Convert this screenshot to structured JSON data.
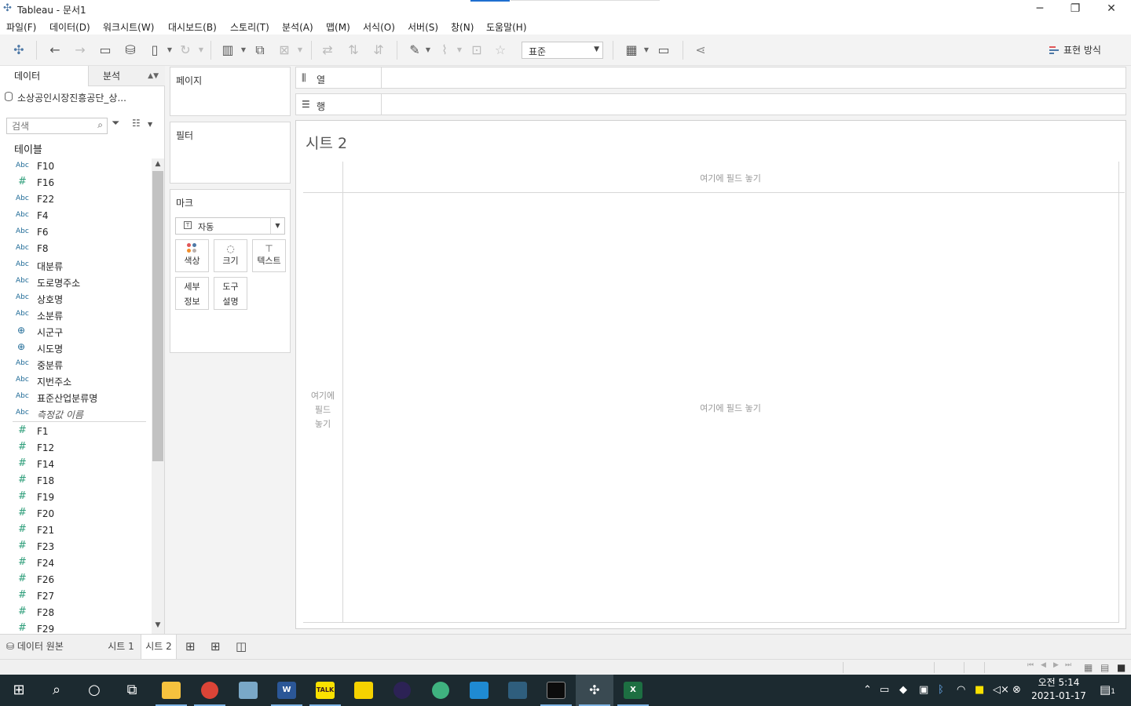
{
  "window": {
    "title": "Tableau - 문서1",
    "controls": {
      "minimize": "─",
      "restore": "❐",
      "close": "✕"
    }
  },
  "menu": [
    "파일(F)",
    "데이터(D)",
    "워크시트(W)",
    "대시보드(B)",
    "스토리(T)",
    "분석(A)",
    "맵(M)",
    "서식(O)",
    "서버(S)",
    "창(N)",
    "도움말(H)"
  ],
  "toolbar": {
    "fit_value": "표준",
    "show_me_label": "표현 방식",
    "icons": [
      "tableau-logo-icon",
      "undo-icon",
      "redo-icon",
      "save-icon",
      "new-datasource-icon",
      "pause-updates-icon",
      "refresh-icon",
      "new-worksheet-icon",
      "duplicate-icon",
      "clear-icon",
      "swap-icon",
      "sort-asc-icon",
      "sort-desc-icon",
      "highlight-icon",
      "group-icon",
      "labels-icon",
      "pin-icon",
      "card-view-icon",
      "presentation-icon",
      "share-icon"
    ]
  },
  "data_pane": {
    "tab_data": "데이터",
    "tab_analysis": "분석",
    "data_source": "소상공인시장진흥공단_상...",
    "search_placeholder": "검색",
    "tables_header": "테이블",
    "dimensions": [
      {
        "type": "Abc",
        "name": "F10"
      },
      {
        "type": "#",
        "name": "F16"
      },
      {
        "type": "Abc",
        "name": "F22"
      },
      {
        "type": "Abc",
        "name": "F4"
      },
      {
        "type": "Abc",
        "name": "F6"
      },
      {
        "type": "Abc",
        "name": "F8"
      },
      {
        "type": "Abc",
        "name": "대분류"
      },
      {
        "type": "Abc",
        "name": "도로명주소"
      },
      {
        "type": "Abc",
        "name": "상호명"
      },
      {
        "type": "Abc",
        "name": "소분류"
      },
      {
        "type": "geo",
        "name": "시군구"
      },
      {
        "type": "geo",
        "name": "시도명"
      },
      {
        "type": "Abc",
        "name": "중분류"
      },
      {
        "type": "Abc",
        "name": "지번주소"
      },
      {
        "type": "Abc",
        "name": "표준산업분류명"
      },
      {
        "type": "Abc",
        "name": "측정값 이름",
        "italic": true
      }
    ],
    "measures": [
      "F1",
      "F12",
      "F14",
      "F18",
      "F19",
      "F20",
      "F21",
      "F23",
      "F24",
      "F26",
      "F27",
      "F28",
      "F29"
    ]
  },
  "cards": {
    "pages": "페이지",
    "filters": "필터",
    "marks": "마크",
    "mark_type": "자동",
    "mark_buttons": {
      "color": "색상",
      "size": "크기",
      "text": "텍스트",
      "detail_1": "세부",
      "detail_2": "정보",
      "tooltip_1": "도구",
      "tooltip_2": "설명"
    }
  },
  "shelves": {
    "columns": "열",
    "rows": "행"
  },
  "view": {
    "title": "시트 2",
    "drop_top": "여기에 필드 놓기",
    "drop_center": "여기에 필드 놓기",
    "drop_left_1": "여기에",
    "drop_left_2": "필드",
    "drop_left_3": "놓기"
  },
  "sheet_tabs": {
    "datasource": "데이터 원본",
    "sheets": [
      "시트 1",
      "시트 2"
    ],
    "active": "시트 2"
  },
  "taskbar": {
    "time": "오전 5:14",
    "date": "2021-01-17",
    "notification_count": "1",
    "apps": [
      "start-icon",
      "search-icon",
      "cortana-icon",
      "task-view-icon",
      "file-explorer-icon",
      "chrome-icon",
      "notepad-icon",
      "word-icon",
      "kakaotalk-icon",
      "sticky-notes-icon",
      "eclipse-icon",
      "git-icon",
      "vscode-icon",
      "mysql-workbench-icon",
      "terminal-icon",
      "tableau-icon",
      "excel-icon"
    ],
    "kakao_label": "TALK",
    "word_label": "W",
    "excel_label": "X"
  }
}
